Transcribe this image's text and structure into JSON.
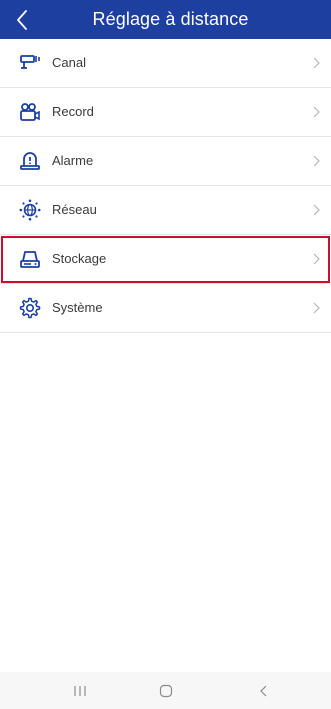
{
  "header": {
    "title": "Réglage à distance",
    "back_icon": "chevron-left-icon",
    "background": "#1d3fa0"
  },
  "menu": {
    "items": [
      {
        "label": "Canal",
        "icon": "camera-icon"
      },
      {
        "label": "Record",
        "icon": "video-record-icon"
      },
      {
        "label": "Alarme",
        "icon": "alarm-light-icon"
      },
      {
        "label": "Réseau",
        "icon": "network-globe-icon"
      },
      {
        "label": "Stockage",
        "icon": "hard-drive-icon",
        "highlighted": true
      },
      {
        "label": "Système",
        "icon": "gear-icon"
      }
    ],
    "highlight_color": "#c8102e",
    "icon_color": "#1d3fa0"
  },
  "system_nav": {
    "buttons": [
      "recent-apps-icon",
      "home-icon",
      "back-icon"
    ]
  }
}
